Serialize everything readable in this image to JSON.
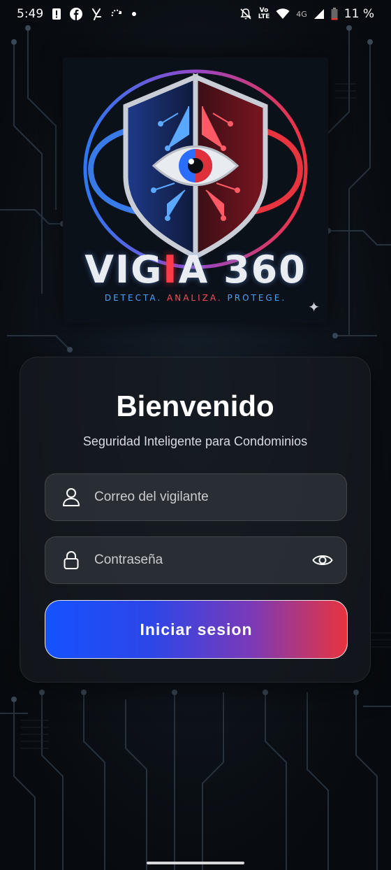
{
  "status_bar": {
    "time": "5:49",
    "volte_top": "Vo",
    "volte_bottom": "LTE",
    "network": "4G",
    "battery": "11 %"
  },
  "logo": {
    "name_part1": "VIG",
    "name_accent": "I",
    "name_part2": "A 360",
    "tagline_part1": "DETECTA.",
    "tagline_part2": "ANALIZA.",
    "tagline_part3": "PROTEGE."
  },
  "login": {
    "title": "Bienvenido",
    "subtitle": "Seguridad Inteligente para Condominios",
    "email_placeholder": "Correo del vigilante",
    "email_value": "",
    "password_placeholder": "Contraseña",
    "password_value": "",
    "submit_label": "Iniciar sesion"
  },
  "colors": {
    "accent_blue": "#1552ff",
    "accent_red": "#e8343e",
    "background": "#0a0e13"
  },
  "icons": [
    "user-icon",
    "lock-icon",
    "eye-icon",
    "sparkle-icon"
  ]
}
